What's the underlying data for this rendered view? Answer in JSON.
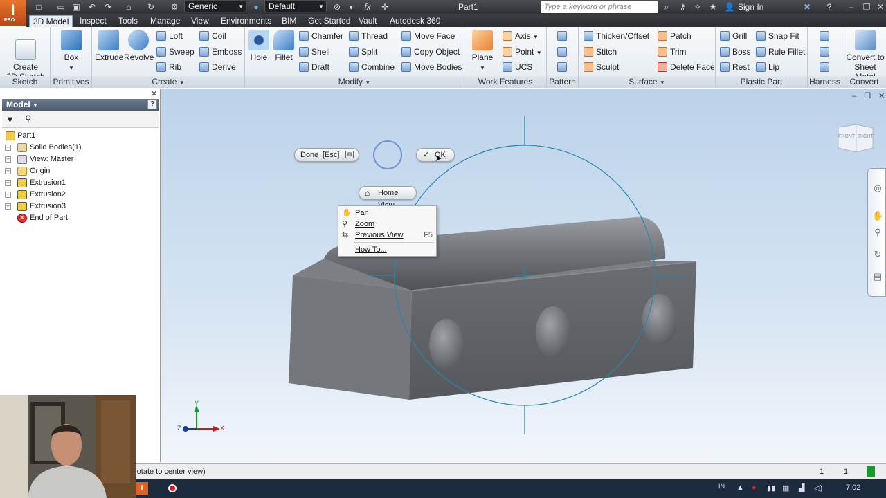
{
  "app": {
    "logo_letter": "I",
    "logo_sub": "PRO",
    "document_title": "Part1"
  },
  "qat": {
    "material": "Generic",
    "appearance": "Default",
    "search_placeholder": "Type a keyword or phrase",
    "sign_in": "Sign In"
  },
  "tabs": [
    {
      "label": "3D Model",
      "active": true
    },
    {
      "label": "Inspect"
    },
    {
      "label": "Tools"
    },
    {
      "label": "Manage"
    },
    {
      "label": "View"
    },
    {
      "label": "Environments"
    },
    {
      "label": "BIM"
    },
    {
      "label": "Get Started"
    },
    {
      "label": "Vault"
    },
    {
      "label": "Autodesk 360"
    }
  ],
  "ribbon": {
    "sketch": {
      "title": "Sketch",
      "create_2d_sketch": "Create\n2D Sketch"
    },
    "primitives": {
      "title": "Primitives",
      "box": "Box"
    },
    "create": {
      "title": "Create",
      "extrude": "Extrude",
      "revolve": "Revolve",
      "loft": "Loft",
      "sweep": "Sweep",
      "rib": "Rib",
      "coil": "Coil",
      "emboss": "Emboss",
      "derive": "Derive"
    },
    "modify": {
      "title": "Modify",
      "hole": "Hole",
      "fillet": "Fillet",
      "chamfer": "Chamfer",
      "shell": "Shell",
      "draft": "Draft",
      "thread": "Thread",
      "split": "Split",
      "combine": "Combine",
      "move_face": "Move Face",
      "copy_object": "Copy Object",
      "move_bodies": "Move Bodies"
    },
    "work_features": {
      "title": "Work Features",
      "plane": "Plane",
      "axis": "Axis",
      "point": "Point",
      "ucs": "UCS"
    },
    "pattern": {
      "title": "Pattern"
    },
    "surface": {
      "title": "Surface",
      "thicken_offset": "Thicken/Offset",
      "stitch": "Stitch",
      "sculpt": "Sculpt",
      "patch": "Patch",
      "trim": "Trim",
      "delete_face": "Delete Face"
    },
    "plastic_part": {
      "title": "Plastic Part",
      "grill": "Grill",
      "boss": "Boss",
      "rest": "Rest",
      "snap_fit": "Snap Fit",
      "rule_fillet": "Rule Fillet",
      "lip": "Lip"
    },
    "harness": {
      "title": "Harness"
    },
    "convert": {
      "title": "Convert",
      "convert_to_sheet_metal": "Convert to\nSheet Metal"
    }
  },
  "browser": {
    "title": "Model",
    "items": [
      {
        "label": "Part1"
      },
      {
        "label": "Solid Bodies(1)"
      },
      {
        "label": "View: Master"
      },
      {
        "label": "Origin"
      },
      {
        "label": "Extrusion1"
      },
      {
        "label": "Extrusion2"
      },
      {
        "label": "Extrusion3"
      },
      {
        "label": "End of Part"
      }
    ]
  },
  "viewport": {
    "done_label": "Done",
    "esc_label": "[Esc]",
    "ok_label": "OK",
    "home_view_label": "Home View",
    "context_menu": [
      {
        "label": "Pan",
        "shortcut": ""
      },
      {
        "label": "Zoom",
        "shortcut": ""
      },
      {
        "label": "Previous View",
        "shortcut": "F5"
      },
      {
        "label": "How To...",
        "shortcut": ""
      }
    ],
    "viewcube": {
      "front": "FRONT",
      "right": "RIGHT"
    },
    "triad": {
      "x": "X",
      "y": "Y",
      "z": "Z"
    }
  },
  "status": {
    "text": "rotate to center view)",
    "num1": "1",
    "num2": "1"
  },
  "taskbar": {
    "lang": "IN",
    "clock": "7:02"
  }
}
